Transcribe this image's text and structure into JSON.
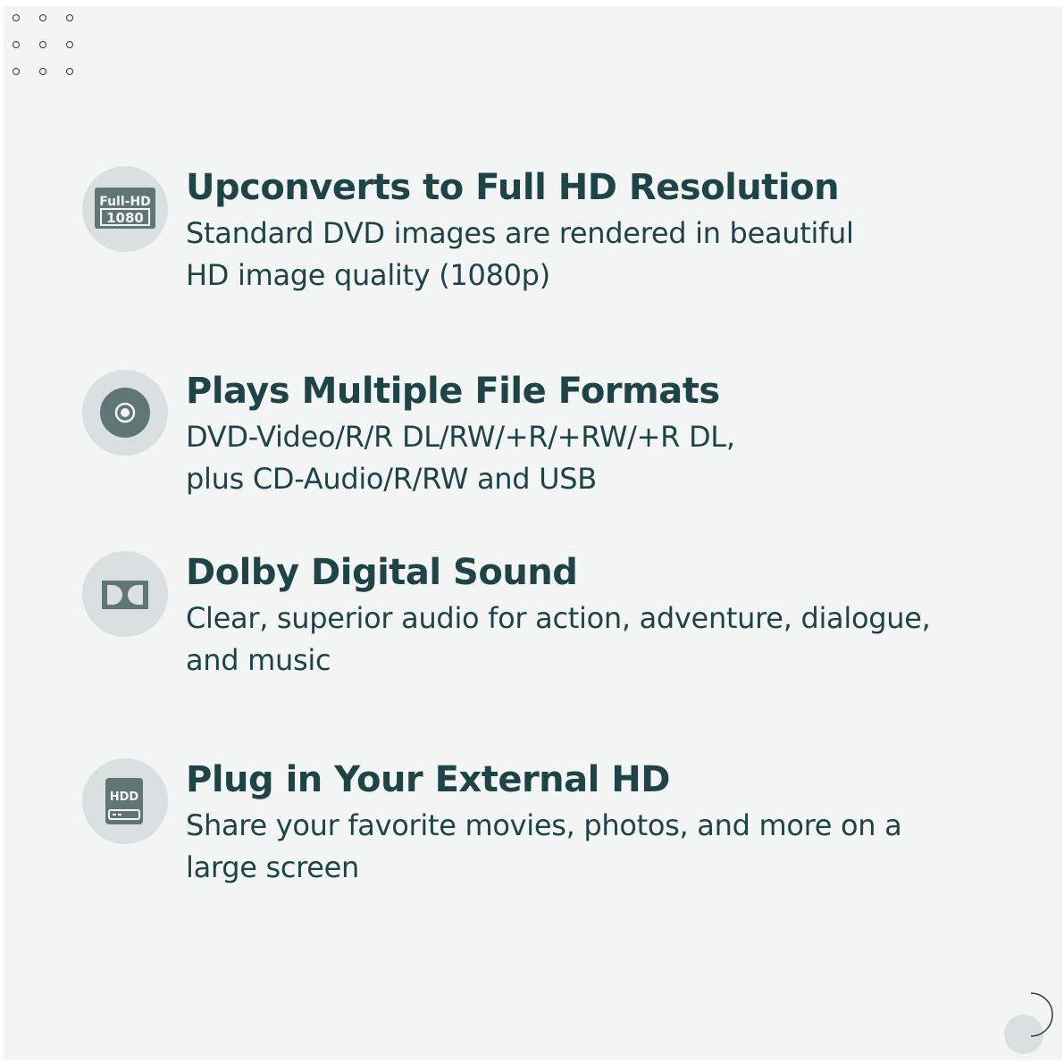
{
  "colors": {
    "background": "#f3f4f4",
    "icon_circle": "#dadfdf",
    "icon_fill": "#5f7576",
    "text": "#1e4447"
  },
  "features": [
    {
      "icon": "full-hd-1080-icon",
      "icon_text_top": "Full-HD",
      "icon_text_bottom": "1080",
      "title": "Upconverts to Full HD Resolution",
      "desc_line1": "Standard DVD images are rendered in beautiful",
      "desc_line2": "HD image quality (1080p)"
    },
    {
      "icon": "disc-icon",
      "title": "Plays Multiple File Formats",
      "desc_line1": "DVD-Video/R/R DL/RW/+R/+RW/+R DL,",
      "desc_line2": "plus CD-Audio/R/RW and USB"
    },
    {
      "icon": "dolby-icon",
      "title": "Dolby Digital Sound",
      "desc_line1": "Clear, superior audio for action, adventure, dialogue,",
      "desc_line2": "and music"
    },
    {
      "icon": "hdd-icon",
      "icon_text": "HDD",
      "title": "Plug in Your External HD",
      "desc_line1": "Share your favorite movies, photos, and more on a",
      "desc_line2": "large screen"
    }
  ]
}
